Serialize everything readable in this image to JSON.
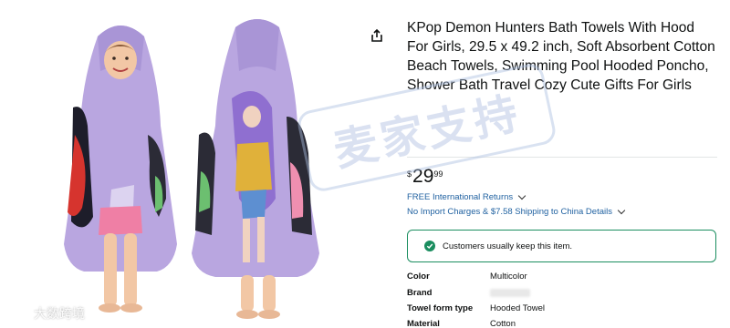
{
  "product": {
    "title": "KPop Demon Hunters Bath Towels With Hood For Girls, 29.5 x 49.2 inch, Soft Absorbent Cotton Beach Towels, Swimming Pool Hooded Poncho, Shower Bath Travel Cozy Cute Gifts For Girls",
    "price_symbol": "$",
    "price_whole": "29",
    "price_fraction": "99",
    "returns_label": "FREE International Returns",
    "shipping_label": "No Import Charges & $7.58 Shipping to China Details",
    "keep_message": "Customers usually keep this item."
  },
  "specs": [
    {
      "key": "Color",
      "value": "Multicolor"
    },
    {
      "key": "Brand",
      "value": ""
    },
    {
      "key": "Towel form type",
      "value": "Hooded Towel"
    },
    {
      "key": "Material",
      "value": "Cotton"
    }
  ],
  "colors": {
    "towel_lavender": "#b9a6e0",
    "link_blue": "#2162a1",
    "success_green": "#1a8d5f"
  },
  "watermarks": {
    "stamp_text": "麦家支持",
    "corner_text": "大数跨境"
  }
}
